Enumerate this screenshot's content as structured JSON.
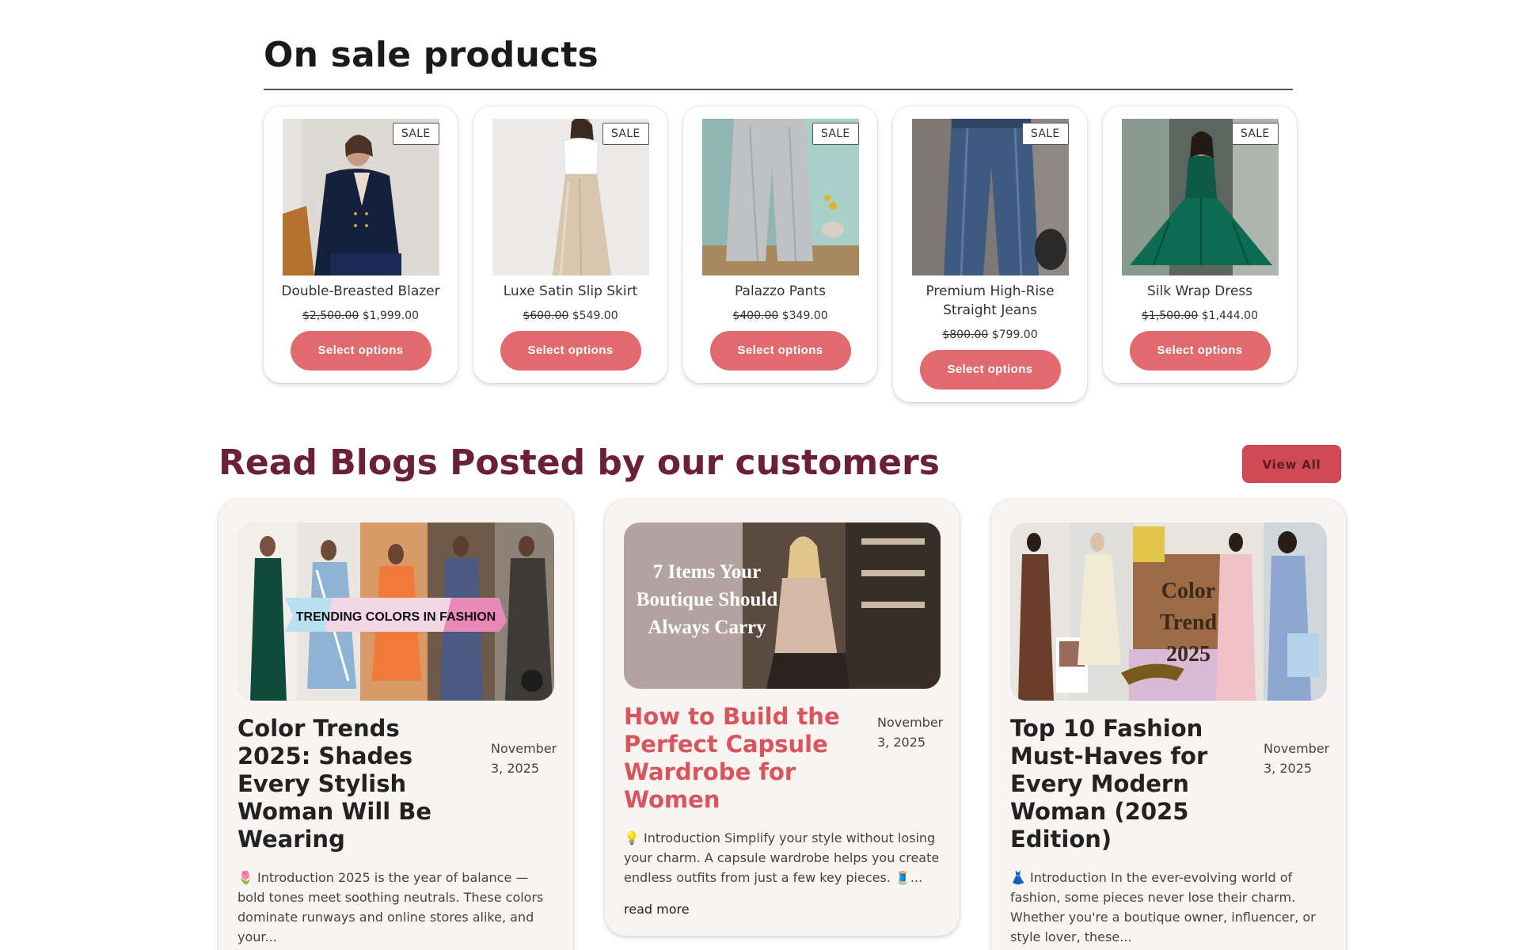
{
  "sale": {
    "title": "On sale products",
    "badge": "SALE",
    "button_label": "Select options",
    "products": [
      {
        "name": "Double-Breasted Blazer",
        "old_price": "$2,500.00",
        "new_price": "$1,999.00"
      },
      {
        "name": "Luxe Satin Slip Skirt",
        "old_price": "$600.00",
        "new_price": "$549.00"
      },
      {
        "name": "Palazzo Pants",
        "old_price": "$400.00",
        "new_price": "$349.00"
      },
      {
        "name": "Premium High-Rise Straight Jeans",
        "old_price": "$800.00",
        "new_price": "$799.00"
      },
      {
        "name": "Silk Wrap Dress",
        "old_price": "$1,500.00",
        "new_price": "$1,444.00"
      }
    ]
  },
  "blog": {
    "title": "Read Blogs Posted by our customers",
    "view_all": "View All",
    "read_more": "read more",
    "posts": [
      {
        "cover_text": "TRENDING COLORS IN FASHION",
        "title": "Color Trends 2025: Shades Every Stylish Woman Will Be Wearing",
        "date": "November 3, 2025",
        "excerpt": "🌷 Introduction 2025 is the year of balance — bold tones meet soothing neutrals. These colors dominate runways and online stores alike, and your..."
      },
      {
        "cover_text": "7 Items Your Boutique Should Always Carry",
        "title": "How to Build the Perfect Capsule Wardrobe for Women",
        "date": "November 3, 2025",
        "excerpt": "💡 Introduction Simplify your style without losing your charm. A capsule wardrobe helps you create endless outfits from just a few key pieces. 🧵..."
      },
      {
        "cover_text": "Color Trend 2025",
        "title": "Top 10 Fashion Must-Haves for Every Modern Woman (2025 Edition)",
        "date": "November 3, 2025",
        "excerpt": "👗 Introduction In the ever-evolving world of fashion, some pieces never lose their charm. Whether you're a boutique owner, influencer, or style lover, these..."
      }
    ]
  },
  "colors": {
    "button": "#e06a6e",
    "blog_heading": "#6b1f3a",
    "accent_title": "#d9545c"
  }
}
